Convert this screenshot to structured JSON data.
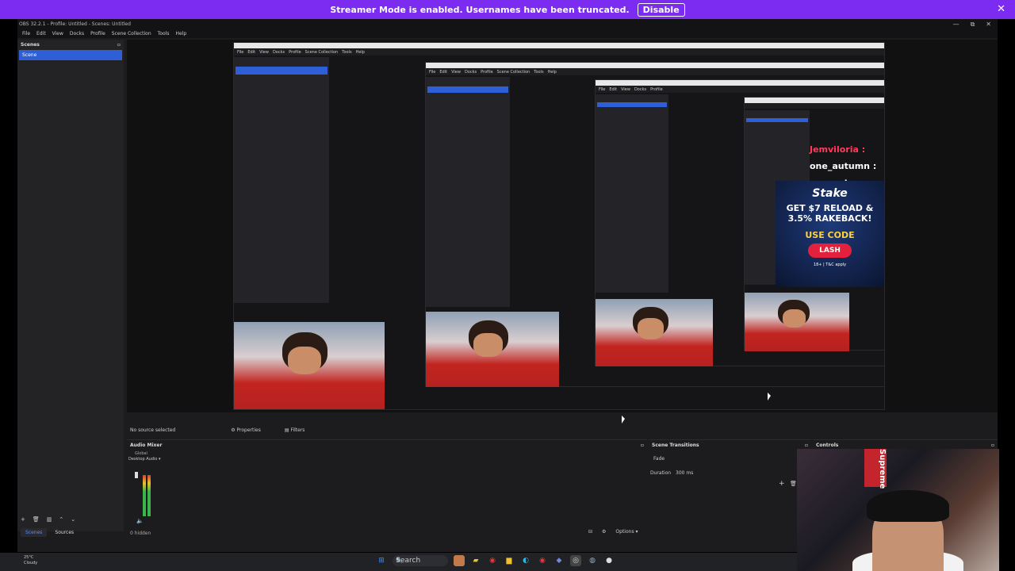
{
  "banner": {
    "message": "Streamer Mode is enabled. Usernames have been truncated.",
    "button": "Disable",
    "close": "✕"
  },
  "window": {
    "title": "OBS 32.2.1 - Profile: Untitled - Scenes: Untitled",
    "min": "—",
    "max": "⧉",
    "close": "✕"
  },
  "menu": [
    "File",
    "Edit",
    "View",
    "Docks",
    "Profile",
    "Scene Collection",
    "Tools",
    "Help"
  ],
  "scenes": {
    "header": "Scenes",
    "items": [
      "Scene"
    ]
  },
  "preview_chat": [
    {
      "user": "Jemviloria :"
    },
    {
      "user": "one_autumn :"
    },
    {
      "user": "one_autumn :"
    }
  ],
  "ad": {
    "brand": "Stake",
    "offer_line1": "GET $7 RELOAD &",
    "offer_line2": "3.5% RAKEBACK!",
    "use_code": "USE CODE",
    "code": "LASH",
    "fine_print": "18+ | T&C apply"
  },
  "source_bar": {
    "status": "No source selected",
    "properties": "Properties",
    "filters": "Filters"
  },
  "audio_mixer": {
    "header": "Audio Mixer",
    "global": "Global",
    "device": "Desktop Audio",
    "hidden": "0 hidden"
  },
  "transitions": {
    "header": "Scene Transitions",
    "type": "Fade",
    "duration_label": "Duration",
    "duration_value": "300 ms"
  },
  "controls": {
    "header": "Controls"
  },
  "options_button": "Options",
  "tabs": {
    "scenes": "Scenes",
    "sources": "Sources"
  },
  "taskbar": {
    "weather_temp": "25°C",
    "weather_desc": "Cloudy",
    "search": "Search"
  },
  "webcam_poster": "Supreme"
}
